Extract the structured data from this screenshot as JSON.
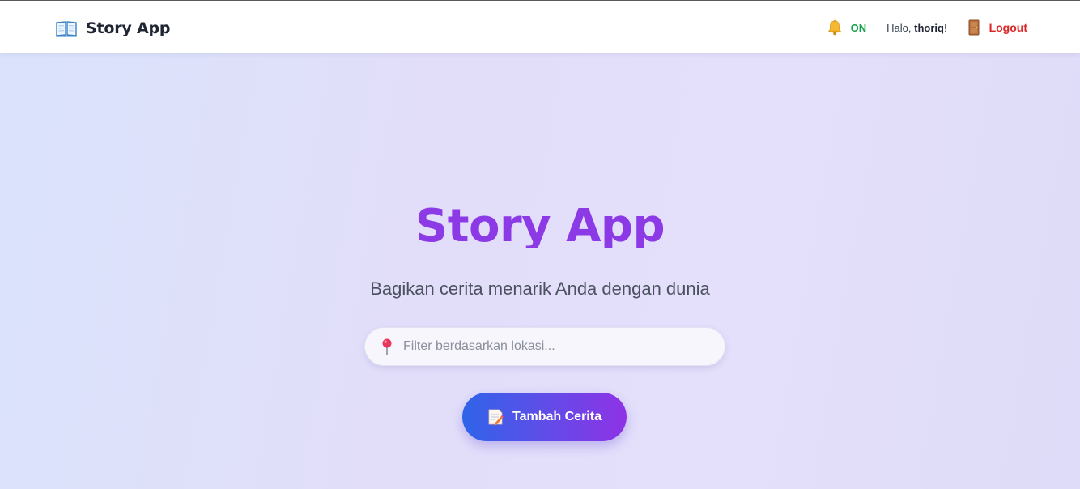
{
  "app": {
    "brand_name": "Story App",
    "brand_icon": "open-book-icon"
  },
  "nav": {
    "notification_icon": "bell-icon",
    "notification_status": "ON",
    "notification_status_color": "#17a34a",
    "greeting_prefix": "Halo, ",
    "username": "thoriq",
    "greeting_suffix": "!",
    "logout_icon": "door-icon",
    "logout_label": "Logout",
    "logout_color": "#dc2626"
  },
  "hero": {
    "title": "Story App",
    "subtitle": "Bagikan cerita menarik Anda dengan dunia",
    "title_color": "#8b3ae6"
  },
  "search": {
    "icon": "pin-icon",
    "placeholder": "Filter berdasarkan lokasi...",
    "value": ""
  },
  "actions": {
    "add_story_icon": "memo-icon",
    "add_story_label": "Tambah Cerita",
    "gradient_start": "#2f64e8",
    "gradient_end": "#8f32e6"
  }
}
